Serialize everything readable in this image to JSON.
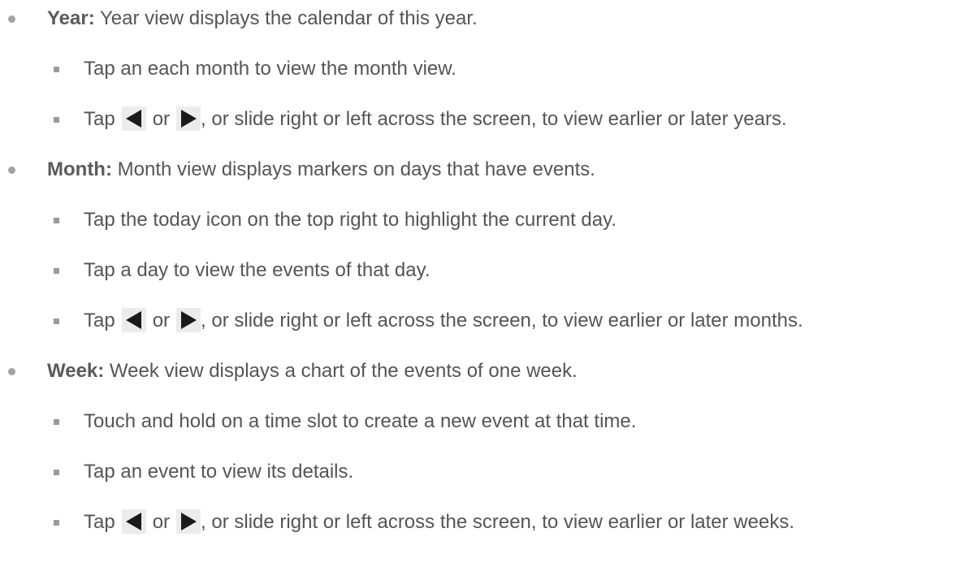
{
  "sections": [
    {
      "term": "Year:",
      "description": " Year view displays the calendar of this year.",
      "items": [
        {
          "text": "Tap an each month to view the month view."
        },
        {
          "prefix": "Tap",
          "or": "or",
          "suffix": ", or slide right or left across the screen, to view earlier or later years."
        }
      ]
    },
    {
      "term": "Month:",
      "description": " Month view displays markers on days that have events.",
      "items": [
        {
          "text": "Tap the today icon on the top right to highlight the current day."
        },
        {
          "text": "Tap a day to view the events of that day."
        },
        {
          "prefix": "Tap",
          "or": "or",
          "suffix": ", or slide right or left across the screen, to view earlier or later months."
        }
      ]
    },
    {
      "term": "Week:",
      "description": " Week view displays a chart of the events of one week.",
      "items": [
        {
          "text": "Touch and hold on a time slot to create a new event at that time."
        },
        {
          "text": "Tap an event to view its details."
        },
        {
          "prefix": "Tap",
          "or": "or",
          "suffix": ", or slide right or left across the screen, to view earlier or later weeks."
        }
      ]
    }
  ],
  "icons": {
    "left": "arrow-left-icon",
    "right": "arrow-right-icon",
    "arrow_color": "#1a1a1a",
    "button_bg": "#ececec"
  }
}
